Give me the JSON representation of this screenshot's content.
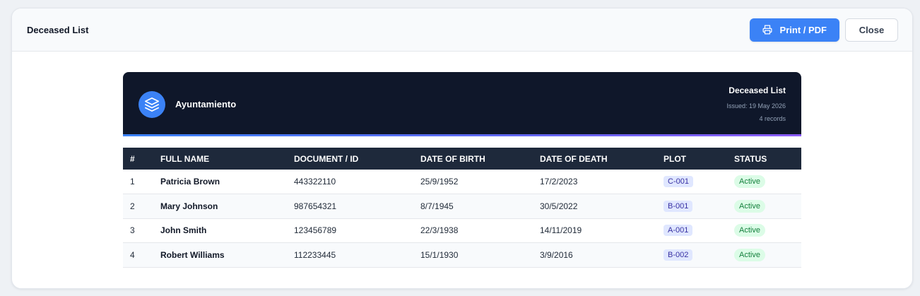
{
  "modal": {
    "title": "Deceased List",
    "print_label": "Print / PDF",
    "close_label": "Close"
  },
  "document": {
    "brand_name": "Ayuntamiento",
    "title": "Deceased List",
    "issued": "Issued: 19 May 2026",
    "records": "4 records"
  },
  "table": {
    "headers": [
      "#",
      "FULL NAME",
      "DOCUMENT / ID",
      "DATE OF BIRTH",
      "DATE OF DEATH",
      "PLOT",
      "STATUS"
    ],
    "rows": [
      {
        "num": "1",
        "name": "Patricia Brown",
        "doc_id": "443322110",
        "birth": "25/9/1952",
        "death": "17/2/2023",
        "plot": "C-001",
        "status": "Active"
      },
      {
        "num": "2",
        "name": "Mary Johnson",
        "doc_id": "987654321",
        "birth": "8/7/1945",
        "death": "30/5/2022",
        "plot": "B-001",
        "status": "Active"
      },
      {
        "num": "3",
        "name": "John Smith",
        "doc_id": "123456789",
        "birth": "22/3/1938",
        "death": "14/11/2019",
        "plot": "A-001",
        "status": "Active"
      },
      {
        "num": "4",
        "name": "Robert Williams",
        "doc_id": "112233445",
        "birth": "15/1/1930",
        "death": "3/9/2016",
        "plot": "B-002",
        "status": "Active"
      }
    ]
  },
  "icons": {
    "print": "printer-icon",
    "logo": "layers-icon"
  },
  "colors": {
    "accent": "#3b82f6",
    "banner": "#0f172a",
    "table_header": "#1e293b",
    "status_active_bg": "#dcfce7",
    "status_active_text": "#15803d",
    "plot_bg": "#e0e7ff"
  }
}
